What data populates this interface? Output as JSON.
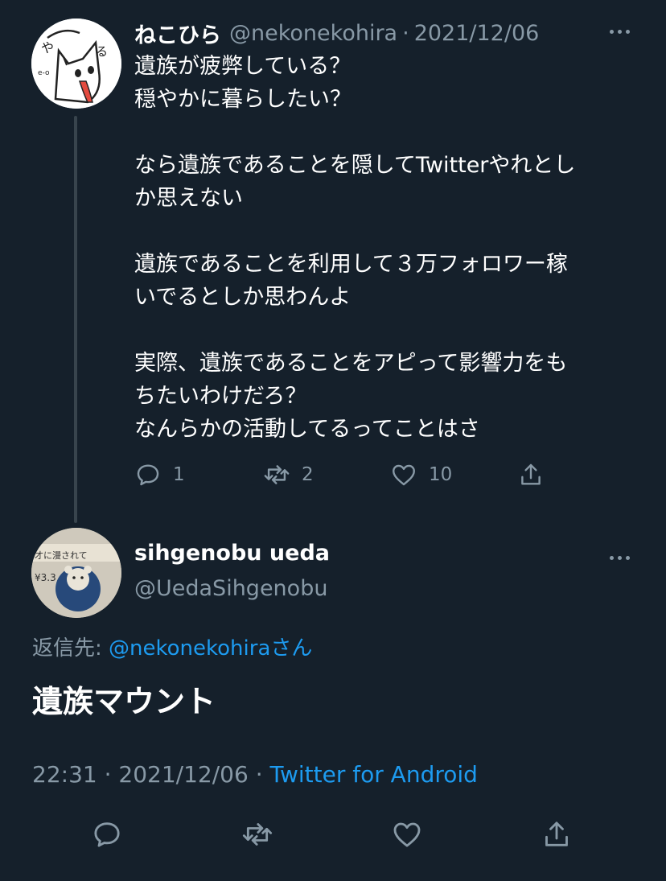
{
  "parent": {
    "display_name": "ねこひら",
    "handle": "@nekonekohira",
    "separator": "·",
    "date": "2021/12/06",
    "lines": [
      "遺族が疲弊している？",
      "穏やかに暮らしたい？",
      "",
      "なら遺族であることを隠してTwitterやれとし",
      "か思えない",
      "",
      "遺族であることを利用して３万フォロワー稼",
      "いでるとしか思わんよ",
      "",
      "実際、遺族であることをアピって影響力をも",
      "ちたいわけだろ？",
      "なんらかの活動してるってことはさ"
    ],
    "reply_count": "1",
    "retweet_count": "2",
    "like_count": "10"
  },
  "main": {
    "display_name": "sihgenobu ueda",
    "handle": "@UedaSihgenobu",
    "reply_prefix": "返信先: ",
    "reply_mention": "@nekonekohira",
    "reply_suffix": "さん",
    "text": "遺族マウント",
    "time": "22:31",
    "separator": "·",
    "date": "2021/12/06",
    "source": "Twitter for Android"
  },
  "colors": {
    "background": "#15202b",
    "text_primary": "#ffffff",
    "text_secondary": "#8899a6",
    "accent": "#1d9bf0",
    "thread_line": "#38444d"
  },
  "icons": [
    "reply-icon",
    "retweet-icon",
    "like-icon",
    "share-icon",
    "more-icon"
  ]
}
